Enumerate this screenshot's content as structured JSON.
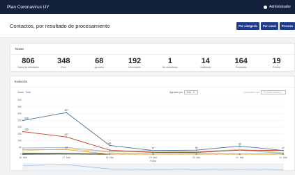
{
  "app": {
    "title": "Plan Coronavirus UY",
    "user": "Administrador"
  },
  "page": {
    "title": "Contactos, por resultado de procesamiento"
  },
  "buttons": [
    "Por categoría",
    "Por canal",
    "Procesa"
  ],
  "totals": {
    "heading": "Totales",
    "items": [
      {
        "value": "806",
        "label": "Todos los resultados"
      },
      {
        "value": "348",
        "label": "Error"
      },
      {
        "value": "68",
        "label": "Ignorado"
      },
      {
        "value": "192",
        "label": "Información"
      },
      {
        "value": "1",
        "label": "No encontrado"
      },
      {
        "value": "14",
        "label": "Notificado"
      },
      {
        "value": "164",
        "label": "Procesado"
      },
      {
        "value": "19",
        "label": "Prueba"
      }
    ]
  },
  "evolution": {
    "heading": "Evolución",
    "zoom_label": "Zoom",
    "zoom_link": "Todo",
    "group_label": "Agrupar por",
    "group_value": "Día",
    "compare_label": "Comparar con",
    "compare_value": "Período anterior"
  },
  "chart_data": {
    "type": "line",
    "xlabel": "Fecha",
    "ylabel": "",
    "categories": [
      "16. Mar",
      "17. Mar",
      "18. Mar",
      "19. Mar",
      "20. Mar",
      "21. Mar",
      "22. Mar"
    ],
    "ylim": [
      0,
      400
    ],
    "yticks": [
      0,
      50,
      100,
      150,
      200,
      250,
      300,
      350,
      400
    ],
    "series": [
      {
        "name": "Todos los resultados",
        "color": "#4a7394",
        "values": [
          249,
          307,
          64,
          27,
          30,
          60,
          27
        ],
        "labels": [
          "249",
          "307",
          "64",
          "",
          "30",
          "60",
          ""
        ]
      },
      {
        "name": "Error",
        "color": "#c0392b",
        "values": [
          166,
          127,
          30,
          13,
          13,
          30,
          27
        ],
        "labels": [
          "166",
          "127",
          "",
          "",
          "",
          "",
          "27"
        ]
      },
      {
        "name": "Ignorado",
        "color": "#e0a630",
        "values": [
          34,
          34,
          0,
          0,
          0,
          0,
          0
        ],
        "labels": [
          "",
          "34",
          "",
          "",
          "",
          "",
          ""
        ]
      },
      {
        "name": "Información",
        "color": "#8fb9d6",
        "values": [
          45,
          50,
          19,
          27,
          20,
          30,
          5
        ],
        "labels": [
          "",
          "",
          "",
          "27",
          "",
          "",
          ""
        ]
      },
      {
        "name": "No encontrado",
        "color": "#222222",
        "values": [
          0,
          1,
          0,
          0,
          0,
          0,
          0
        ],
        "labels": [
          "",
          "",
          "",
          "",
          "",
          "",
          ""
        ]
      },
      {
        "name": "Notificado",
        "color": "#b07aa1",
        "values": [
          4,
          3,
          2,
          1,
          2,
          1,
          1
        ],
        "labels": [
          "",
          "",
          "",
          "",
          "",
          "",
          ""
        ]
      },
      {
        "name": "Procesado",
        "color": "#f0c36d",
        "values": [
          25,
          40,
          15,
          20,
          18,
          35,
          11
        ],
        "labels": [
          "",
          "",
          "",
          "",
          "",
          "",
          ""
        ]
      },
      {
        "name": "Prueba",
        "color": "#5b8c5a",
        "values": [
          8,
          5,
          2,
          1,
          1,
          1,
          1
        ],
        "labels": [
          "",
          "",
          "",
          "",
          "",
          "",
          ""
        ]
      }
    ]
  }
}
